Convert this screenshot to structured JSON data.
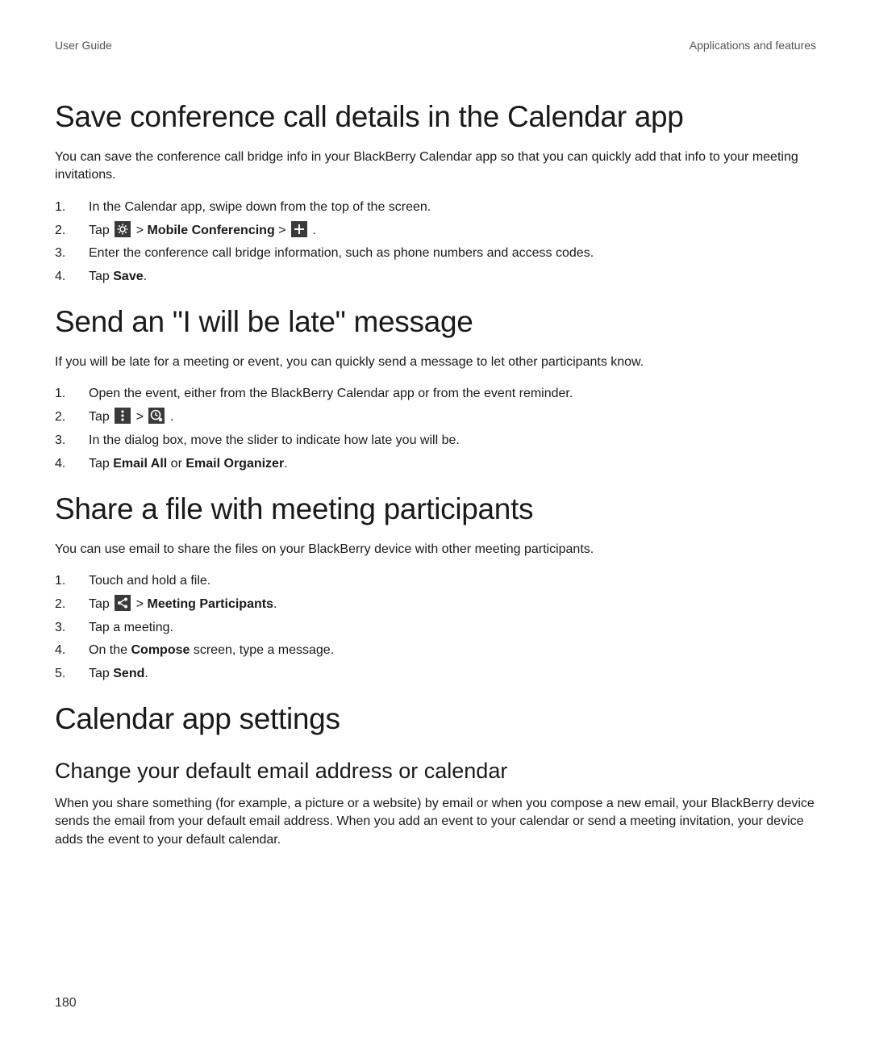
{
  "header": {
    "left": "User Guide",
    "right": "Applications and features"
  },
  "section1": {
    "title": "Save conference call details in the Calendar app",
    "intro": "You can save the conference call bridge info in your BlackBerry Calendar app so that you can quickly add that info to your meeting invitations.",
    "steps": {
      "s1": "In the Calendar app, swipe down from the top of the screen.",
      "s2_pre": "Tap ",
      "s2_bold": "Mobile Conferencing",
      "s2_gt1": " > ",
      "s2_gt2": " > ",
      "s2_post": " .",
      "s3": "Enter the conference call bridge information, such as phone numbers and access codes.",
      "s4_pre": "Tap ",
      "s4_bold": "Save",
      "s4_post": "."
    }
  },
  "section2": {
    "title": "Send an \"I will be late\" message",
    "intro": "If you will be late for a meeting or event, you can quickly send a message to let other participants know.",
    "steps": {
      "s1": "Open the event, either from the BlackBerry Calendar app or from the event reminder.",
      "s2_pre": "Tap ",
      "s2_mid": " > ",
      "s2_post": " .",
      "s3": "In the dialog box, move the slider to indicate how late you will be.",
      "s4_pre": "Tap ",
      "s4_bold1": "Email All",
      "s4_or": " or ",
      "s4_bold2": "Email Organizer",
      "s4_post": "."
    }
  },
  "section3": {
    "title": "Share a file with meeting participants",
    "intro": "You can use email to share the files on your BlackBerry device with other meeting participants.",
    "steps": {
      "s1": "Touch and hold a file.",
      "s2_pre": "Tap ",
      "s2_mid": " > ",
      "s2_bold": "Meeting Participants",
      "s2_post": ".",
      "s3": "Tap a meeting.",
      "s4_pre": "On the ",
      "s4_bold": "Compose",
      "s4_post": " screen, type a message.",
      "s5_pre": "Tap ",
      "s5_bold": "Send",
      "s5_post": "."
    }
  },
  "section4": {
    "title": "Calendar app settings",
    "sub": {
      "title": "Change your default email address or calendar",
      "intro": "When you share something (for example, a picture or a website) by email or when you compose a new email, your BlackBerry device sends the email from your default email address. When you add an event to your calendar or send a meeting invitation, your device adds the event to your default calendar."
    }
  },
  "page_number": "180"
}
